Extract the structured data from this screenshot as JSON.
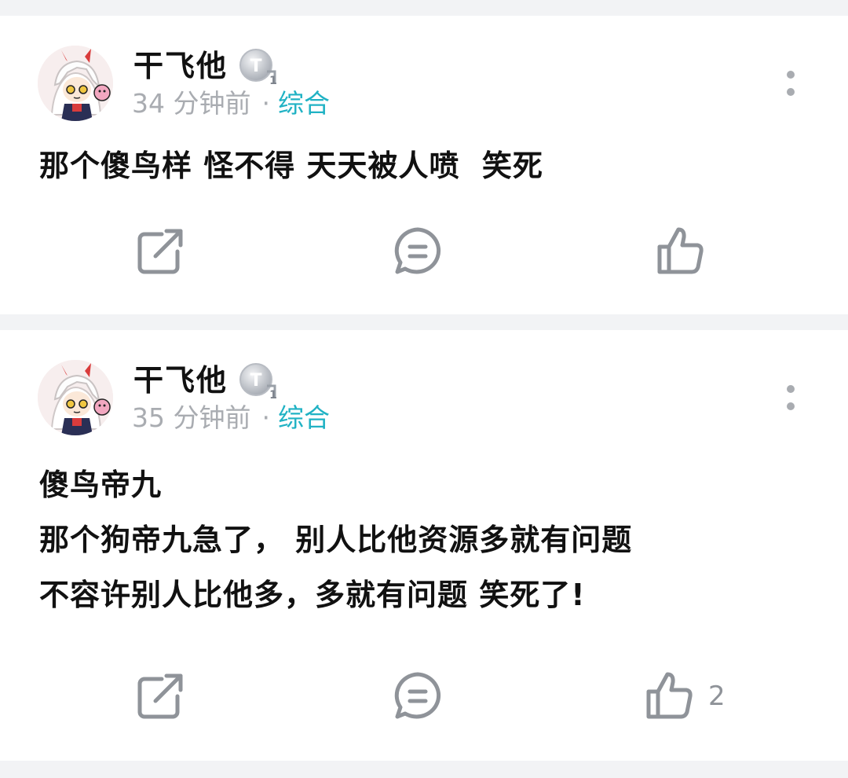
{
  "posts": [
    {
      "author": "干飞他",
      "time": "34 分钟前",
      "separator": "·",
      "category": "综合",
      "content": "那个傻鸟样 怪不得 天天被人喷  笑死",
      "like_count": ""
    },
    {
      "author": "干飞他",
      "time": "35 分钟前",
      "separator": "·",
      "category": "综合",
      "content": "傻鸟帝九\n那个狗帝九急了， 别人比他资源多就有问题\n不容许别人比他多，多就有问题 笑死了!",
      "like_count": "2"
    }
  ],
  "colors": {
    "category": "#20b2c4",
    "meta": "#a9acb1",
    "icon": "#8f9399",
    "background": "#f2f3f5"
  },
  "icons": [
    "share-icon",
    "comment-icon",
    "thumbs-up-icon",
    "more-options-icon",
    "user-badge-icon"
  ]
}
